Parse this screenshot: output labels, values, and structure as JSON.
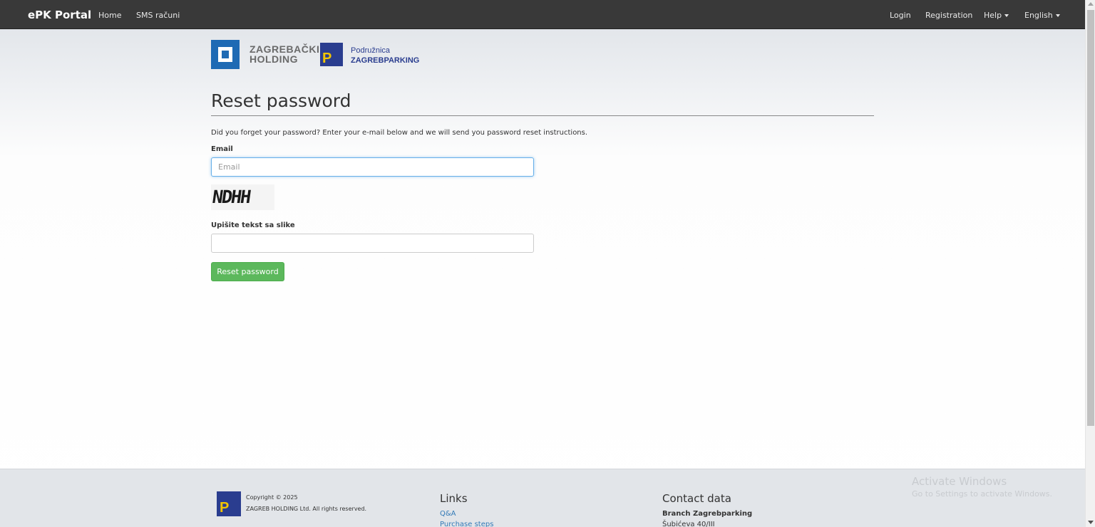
{
  "navbar": {
    "brand": "ePK Portal",
    "left_links": [
      "Home",
      "SMS računi"
    ],
    "right_links": [
      "Login",
      "Registration"
    ],
    "help_label": "Help",
    "language_label": "English"
  },
  "logos": {
    "holding_line1": "ZAGREBAČKI",
    "holding_line2": "HOLDING",
    "branch_line1": "Podružnica",
    "branch_line2": "ZAGREBPARKING"
  },
  "page": {
    "title": "Reset password",
    "intro": "Did you forget your password? Enter your e-mail below and we will send you password reset instructions.",
    "email_label": "Email",
    "email_placeholder": "Email",
    "email_value": "",
    "captcha_text": "NDHH",
    "captcha_label": "Upišite tekst sa slike",
    "captcha_value": "",
    "submit_label": "Reset password"
  },
  "footer": {
    "copyright_line1": "Copyright © 2025",
    "copyright_line2": "ZAGREB HOLDING Ltd. All rights reserved.",
    "links_heading": "Links",
    "links": [
      "Q&A",
      "Purchase steps"
    ],
    "contact_heading": "Contact data",
    "branch_name": "Branch Zagrebparking",
    "address": "Šubićeva 40/III"
  },
  "watermark": {
    "line1": "Activate Windows",
    "line2": "Go to Settings to activate Windows."
  },
  "colors": {
    "navbar_bg": "#393939",
    "button_green": "#5cb85c",
    "link_blue": "#337ab7",
    "brand_blue": "#2a3d8f",
    "holding_blue": "#1e6ab4"
  }
}
